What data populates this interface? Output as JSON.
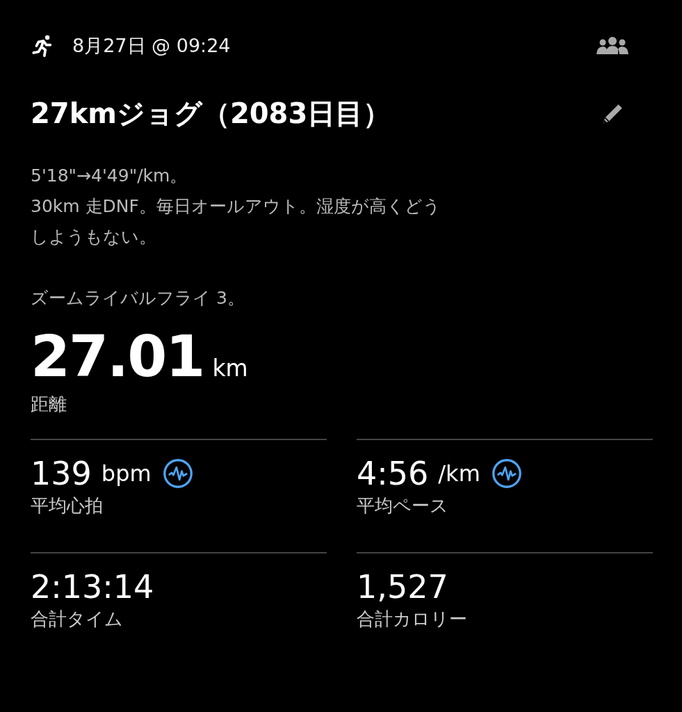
{
  "header": {
    "date": "8月27日 @ 09:24"
  },
  "title": "27kmジョグ（2083日目）",
  "description": {
    "lines": [
      "5'18\"→4'49\"/km。",
      "30km 走DNF。毎日オールアウト。湿度が高くどう",
      "しようもない。"
    ],
    "note": "ズームライバルフライ 3。"
  },
  "distance": {
    "value": "27.01",
    "unit": "km",
    "label": "距離"
  },
  "stats": [
    {
      "kind": "graph",
      "value": "139",
      "unit": "bpm",
      "label": "平均心拍"
    },
    {
      "kind": "graph",
      "value": "4:56",
      "unit": "/km",
      "label": "平均ペース"
    },
    {
      "kind": "plain",
      "value": "2:13:14",
      "label": "合計タイム"
    },
    {
      "kind": "plain",
      "value": "1,527",
      "label": "合計カロリー"
    }
  ]
}
